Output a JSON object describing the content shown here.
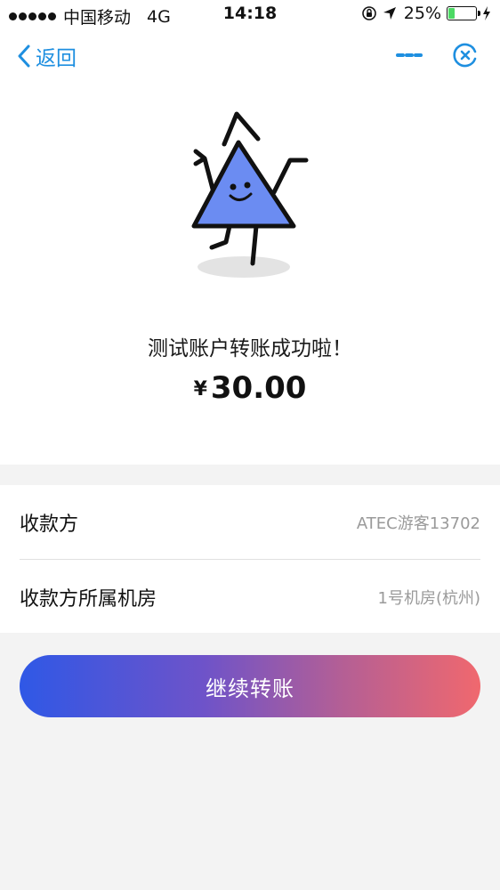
{
  "status_bar": {
    "carrier": "中国移动",
    "network": "4G",
    "time": "14:18",
    "battery_percent": "25%",
    "battery_level": 0.25
  },
  "nav": {
    "back_label": "返回",
    "more_icon": "more-icon",
    "close_icon": "close-icon",
    "accent_color": "#1e8fe0"
  },
  "result": {
    "message": "测试账户转账成功啦！",
    "currency_symbol": "¥",
    "amount": "30.00"
  },
  "details": [
    {
      "label": "收款方",
      "value": "ATEC游客13702"
    },
    {
      "label": "收款方所属机房",
      "value": "1号机房(杭州)"
    }
  ],
  "actions": {
    "continue_label": "继续转账",
    "gradient_start": "#2f58e6",
    "gradient_end": "#f0686e"
  },
  "mascot": {
    "fill_color": "#6b8cf2"
  }
}
